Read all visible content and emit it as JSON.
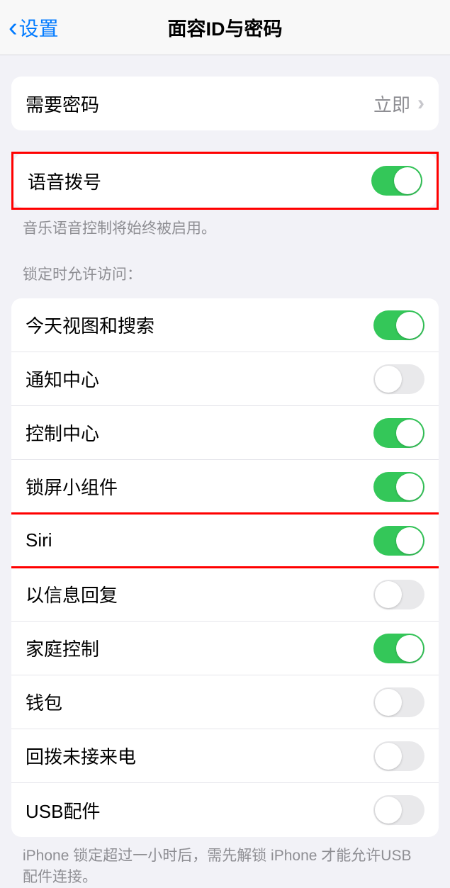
{
  "navbar": {
    "back_label": "设置",
    "title": "面容ID与密码"
  },
  "passcode_section": {
    "require_passcode_label": "需要密码",
    "require_passcode_value": "立即"
  },
  "voice_dial": {
    "label": "语音拨号",
    "enabled": true,
    "footer": "音乐语音控制将始终被启用。"
  },
  "locked_access": {
    "header": "锁定时允许访问：",
    "items": {
      "today_view": {
        "label": "今天视图和搜索",
        "enabled": true
      },
      "notification_center": {
        "label": "通知中心",
        "enabled": false
      },
      "control_center": {
        "label": "控制中心",
        "enabled": true
      },
      "lock_widgets": {
        "label": "锁屏小组件",
        "enabled": true
      },
      "siri": {
        "label": "Siri",
        "enabled": true
      },
      "reply_message": {
        "label": "以信息回复",
        "enabled": false
      },
      "home_control": {
        "label": "家庭控制",
        "enabled": true
      },
      "wallet": {
        "label": "钱包",
        "enabled": false
      },
      "return_missed": {
        "label": "回拨未接来电",
        "enabled": false
      },
      "usb_accessories": {
        "label": "USB配件",
        "enabled": false
      }
    },
    "footer": "iPhone 锁定超过一小时后，需先解锁 iPhone 才能允许USB 配件连接。"
  }
}
